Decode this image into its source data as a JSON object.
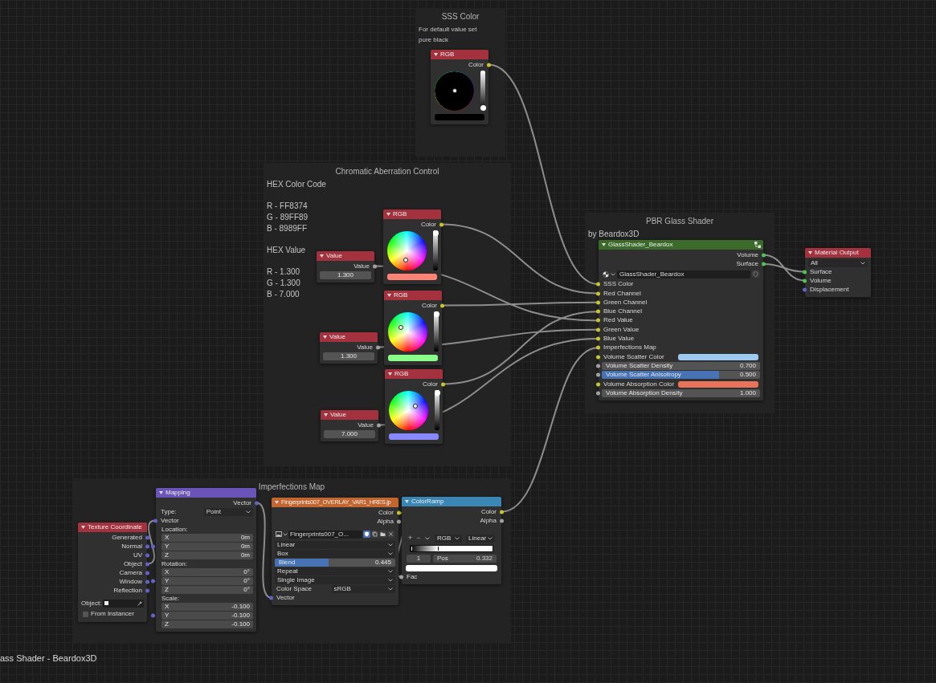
{
  "frames": [
    {
      "title": "SSS Color",
      "notes": [
        [
          "For default value set",
          "pure black"
        ]
      ]
    },
    {
      "title": "Chromatic Aberration Control",
      "notes": [
        [
          "HEX Color Code"
        ],
        [
          "R - FF8374",
          "G - 89FF89",
          "B - 8989FF"
        ],
        [
          "HEX Value"
        ],
        [
          "R - 1.300",
          "G - 1.300",
          "B - 7.000"
        ]
      ]
    },
    {
      "title": "PBR Glass Shader",
      "notes": [
        [
          "by Beardox3D"
        ]
      ]
    },
    {
      "title": "Imperfections Map"
    }
  ],
  "nodes": [
    {
      "kind": "rgb",
      "title": "RGB",
      "color": "#000000",
      "rows": [
        {
          "kind": "output",
          "label": "Color",
          "socket": {
            "color": "#c7c729"
          }
        },
        {
          "kind": "wheel",
          "level": 0
        },
        {
          "kind": "swatch"
        }
      ]
    },
    {
      "kind": "rgb",
      "title": "RGB",
      "color": "#ff8374",
      "rows": [
        {
          "kind": "output",
          "label": "Color",
          "socket": {
            "color": "#c7c729"
          }
        },
        {
          "kind": "wheel",
          "level": 1
        },
        {
          "kind": "swatch"
        }
      ]
    },
    {
      "kind": "value",
      "title": "Value",
      "rows": [
        {
          "kind": "output",
          "label": "Value",
          "socket": {
            "color": "#a1a1a1"
          }
        },
        {
          "kind": "number",
          "value": "1.300"
        }
      ]
    },
    {
      "kind": "rgb",
      "title": "RGB",
      "color": "#89ff89",
      "rows": [
        {
          "kind": "output",
          "label": "Color",
          "socket": {
            "color": "#c7c729"
          }
        },
        {
          "kind": "wheel",
          "level": 1
        },
        {
          "kind": "swatch"
        }
      ]
    },
    {
      "kind": "value",
      "title": "Value",
      "rows": [
        {
          "kind": "output",
          "label": "Value",
          "socket": {
            "color": "#a1a1a1"
          }
        },
        {
          "kind": "number",
          "value": "1.300"
        }
      ]
    },
    {
      "kind": "rgb",
      "title": "RGB",
      "color": "#8989ff",
      "rows": [
        {
          "kind": "output",
          "label": "Color",
          "socket": {
            "color": "#c7c729"
          }
        },
        {
          "kind": "wheel",
          "level": 1
        },
        {
          "kind": "swatch"
        }
      ]
    },
    {
      "kind": "value",
      "title": "Value",
      "rows": [
        {
          "kind": "output",
          "label": "Value",
          "socket": {
            "color": "#a1a1a1"
          }
        },
        {
          "kind": "number",
          "value": "7.000"
        }
      ]
    },
    {
      "kind": "group",
      "title": "GlassShader_Beardox",
      "rows": [
        {
          "kind": "output",
          "label": "Volume",
          "socket": {
            "color": "#4fc24f"
          }
        },
        {
          "kind": "output",
          "label": "Surface",
          "socket": {
            "color": "#4fc24f"
          }
        },
        {
          "kind": "datablock",
          "value": "GlassShader_Beardox"
        },
        {
          "kind": "input",
          "label": "SSS Color",
          "socket": {
            "color": "#c7c729"
          }
        },
        {
          "kind": "input",
          "label": "Red Channel",
          "socket": {
            "color": "#c7c729"
          }
        },
        {
          "kind": "input",
          "label": "Green Channel",
          "socket": {
            "color": "#c7c729"
          }
        },
        {
          "kind": "input",
          "label": "Blue Channel",
          "socket": {
            "color": "#c7c729"
          }
        },
        {
          "kind": "input",
          "label": "Red Value",
          "socket": {
            "color": "#c7c729"
          }
        },
        {
          "kind": "input",
          "label": "Green Value",
          "socket": {
            "color": "#c7c729"
          }
        },
        {
          "kind": "input",
          "label": "Blue Value",
          "socket": {
            "color": "#c7c729"
          }
        },
        {
          "kind": "input",
          "label": "Imperfections Map",
          "socket": {
            "color": "#c7c729"
          }
        },
        {
          "kind": "colorinput",
          "label": "Volume Scatter Color",
          "socket": {
            "color": "#c7c729"
          },
          "color": "#9ccaf0"
        },
        {
          "kind": "number",
          "label": "Volume Scatter Density",
          "value": "0.700",
          "socket": {
            "color": "#a1a1a1"
          }
        },
        {
          "kind": "slider",
          "label": "Volume Scatter Anisotropy",
          "value": "0.500",
          "level": 0.74,
          "socket": {
            "color": "#a1a1a1"
          }
        },
        {
          "kind": "colorinput",
          "label": "Volume Absorption Color",
          "socket": {
            "color": "#c7c729"
          },
          "color": "#e8735a"
        },
        {
          "kind": "number",
          "label": "Volume Absorption Density",
          "value": "1.000",
          "socket": {
            "color": "#a1a1a1"
          }
        }
      ]
    },
    {
      "kind": "output",
      "title": "Material Output",
      "rows": [
        {
          "kind": "dropdown",
          "value": "All"
        },
        {
          "kind": "input",
          "label": "Surface",
          "socket": {
            "color": "#4fc24f"
          }
        },
        {
          "kind": "input",
          "label": "Volume",
          "socket": {
            "color": "#4fc24f"
          }
        },
        {
          "kind": "input",
          "label": "Displacement",
          "socket": {
            "color": "#6363c7"
          }
        }
      ]
    },
    {
      "kind": "texcoord",
      "title": "Texture Coordinate",
      "rows": [
        {
          "kind": "output",
          "label": "Generated",
          "socket": {
            "color": "#6363c7"
          }
        },
        {
          "kind": "output",
          "label": "Normal",
          "socket": {
            "color": "#6363c7"
          }
        },
        {
          "kind": "output",
          "label": "UV",
          "socket": {
            "color": "#6363c7"
          }
        },
        {
          "kind": "output",
          "label": "Object",
          "socket": {
            "color": "#6363c7"
          }
        },
        {
          "kind": "output",
          "label": "Camera",
          "socket": {
            "color": "#6363c7"
          }
        },
        {
          "kind": "output",
          "label": "Window",
          "socket": {
            "color": "#6363c7"
          }
        },
        {
          "kind": "output",
          "label": "Reflection",
          "socket": {
            "color": "#6363c7"
          }
        },
        {
          "kind": "object",
          "label": "Object:"
        },
        {
          "kind": "checkbox",
          "label": "From Instancer",
          "checked": false
        }
      ]
    },
    {
      "kind": "mapping",
      "title": "Mapping",
      "rows": [
        {
          "kind": "output",
          "label": "Vector",
          "socket": {
            "color": "#6363c7"
          }
        },
        {
          "kind": "dropdown",
          "label": "Type:",
          "value": "Point"
        },
        {
          "kind": "input",
          "label": "Vector",
          "socket": {
            "color": "#6363c7"
          }
        },
        {
          "kind": "heading",
          "label": "Location:",
          "socket": {
            "color": "#6363c7"
          },
          "fields": [
            {
              "label": "X",
              "value": "0m"
            },
            {
              "label": "Y",
              "value": "0m"
            },
            {
              "label": "Z",
              "value": "0m"
            }
          ]
        },
        {
          "kind": "heading",
          "label": "Rotation:",
          "socket": {
            "color": "#6363c7"
          },
          "fields": [
            {
              "label": "X",
              "value": "0°"
            },
            {
              "label": "Y",
              "value": "0°"
            },
            {
              "label": "Z",
              "value": "0°"
            }
          ]
        },
        {
          "kind": "heading",
          "label": "Scale:",
          "socket": {
            "color": "#6363c7"
          },
          "fields": [
            {
              "label": "X",
              "value": "-0.100"
            },
            {
              "label": "Y",
              "value": "-0.100"
            },
            {
              "label": "Z",
              "value": "-0.100"
            }
          ]
        }
      ]
    },
    {
      "kind": "image",
      "title": "Fingerprints007_OVERLAY_VAR1_HRES.jp",
      "rows": [
        {
          "kind": "output",
          "label": "Color",
          "socket": {
            "color": "#c7c729"
          }
        },
        {
          "kind": "output",
          "label": "Alpha",
          "socket": {
            "color": "#a1a1a1"
          }
        },
        {
          "kind": "imagefile",
          "value": "Fingerprints007_O..."
        },
        {
          "kind": "dropdown",
          "value": "Linear"
        },
        {
          "kind": "dropdown",
          "value": "Box"
        },
        {
          "kind": "slider",
          "label": "Blend",
          "value": "0.445",
          "level": 0.445
        },
        {
          "kind": "dropdown",
          "value": "Repeat"
        },
        {
          "kind": "dropdown",
          "value": "Single Image"
        },
        {
          "kind": "dropdown",
          "label": "Color Space",
          "value": "sRGB"
        },
        {
          "kind": "input",
          "label": "Vector",
          "socket": {
            "color": "#6363c7"
          }
        }
      ]
    },
    {
      "kind": "colorramp",
      "title": "ColorRamp",
      "rows": [
        {
          "kind": "output",
          "label": "Color",
          "socket": {
            "color": "#c7c729"
          }
        },
        {
          "kind": "output",
          "label": "Alpha",
          "socket": {
            "color": "#a1a1a1"
          }
        },
        {
          "kind": "ramptools",
          "add": "+",
          "remove": "−",
          "mode": "RGB",
          "interpolation": "Linear"
        },
        {
          "kind": "ramp",
          "level": 0.332
        },
        {
          "kind": "stop",
          "index": "1",
          "label": "Pos",
          "value": "0.332"
        },
        {
          "kind": "swatch",
          "color": "#ffffff"
        },
        {
          "kind": "input",
          "label": "Fac",
          "socket": {
            "color": "#a1a1a1"
          }
        }
      ]
    }
  ],
  "footer": "ass Shader - Beardox3D"
}
